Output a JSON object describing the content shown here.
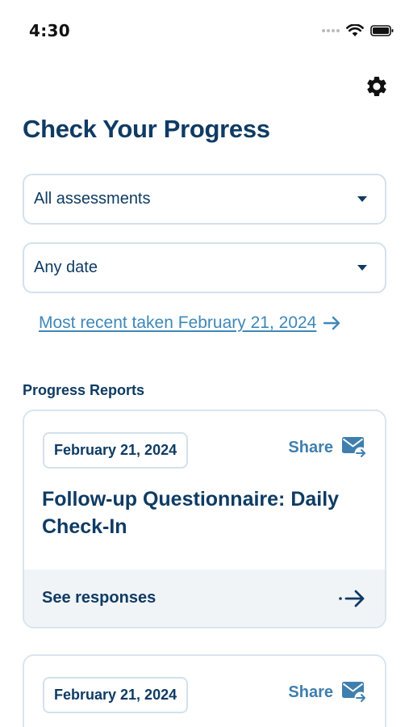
{
  "status_bar": {
    "time": "4:30"
  },
  "header": {
    "settings_icon": "gear-icon",
    "title": "Check Your Progress"
  },
  "filters": {
    "assessment": {
      "selected": "All assessments"
    },
    "date": {
      "selected": "Any date"
    }
  },
  "recent_link": {
    "label": "Most recent taken February 21, 2024"
  },
  "reports": {
    "heading": "Progress Reports",
    "items": [
      {
        "date": "February 21, 2024",
        "share_label": "Share",
        "title": "Follow-up Questionnaire: Daily Check-In",
        "footer_label": "See responses"
      },
      {
        "date": "February 21, 2024",
        "share_label": "Share"
      }
    ]
  },
  "colors": {
    "primary": "#0f3b63",
    "link": "#3e88b8",
    "share": "#3f7fae",
    "border": "#d3e1ec",
    "footer_bg": "#f1f4f7"
  }
}
